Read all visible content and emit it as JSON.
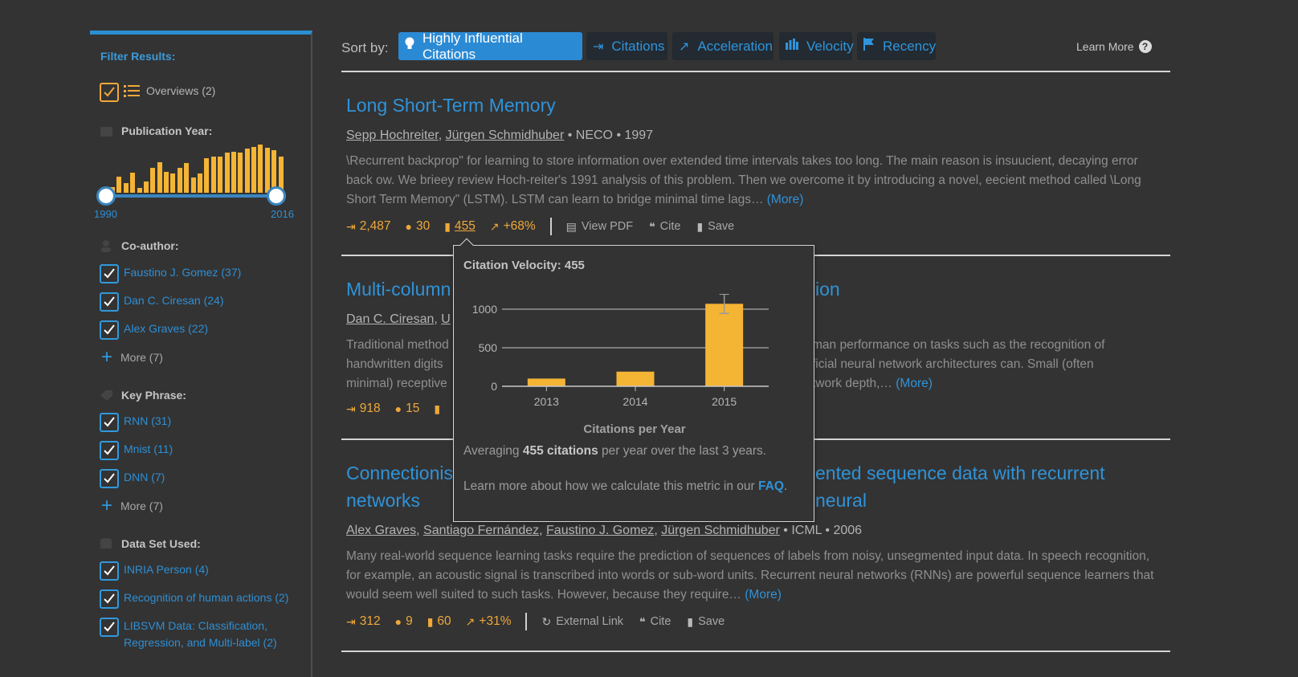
{
  "sidebar": {
    "filter_title": "Filter Results:",
    "overviews_label": "Overviews (2)",
    "pub_year_heading": "Publication Year:",
    "year_start": "1990",
    "year_end": "2016",
    "histogram_levels": [
      0.12,
      0.32,
      0.2,
      0.4,
      0.1,
      0.22,
      0.5,
      0.62,
      0.42,
      0.38,
      0.5,
      0.6,
      0.3,
      0.38,
      0.7,
      0.72,
      0.72,
      0.8,
      0.82,
      0.8,
      0.88,
      0.92,
      0.96,
      0.9,
      0.86,
      0.72
    ],
    "coauthor_heading": "Co-author:",
    "coauthors": [
      "Faustino J. Gomez (37)",
      "Dan C. Ciresan (24)",
      "Alex Graves (22)"
    ],
    "coauthor_more": "More (7)",
    "keyphrase_heading": "Key Phrase:",
    "keyphrases": [
      "RNN (31)",
      "Mnist (11)",
      "DNN (7)"
    ],
    "keyphrase_more": "More (7)",
    "dataset_heading": "Data Set Used:",
    "datasets": [
      "INRIA Person (4)",
      "Recognition of human actions (2)",
      "LIBSVM Data: Classification, Regression, and Multi-label (2)"
    ]
  },
  "sortbar": {
    "label": "Sort by:",
    "options": [
      "Highly Influential Citations",
      "Citations",
      "Acceleration",
      "Velocity",
      "Recency"
    ],
    "learn_more": "Learn More",
    "help_glyph": "?"
  },
  "results": [
    {
      "title": "Long Short-Term Memory",
      "authors": [
        "Sepp Hochreiter",
        "Jürgen Schmidhuber"
      ],
      "venue_year": "• NECO • 1997",
      "abstract": "\\Recurrent backprop\" for learning to store information over extended time intervals takes too long. The main reason is insuucient, decaying error back ow. We brieey review Hoch-reiter's 1991 analysis of this problem. Then we overcome it by introducing a novel, eecient method called \\Long Short Term Memory\" (LSTM). LSTM can learn to bridge minimal time lags…",
      "more": "(More)",
      "citations": "2,487",
      "influential": "30",
      "velocity": "455",
      "acceleration": "+68%",
      "actions": [
        "View PDF",
        "Cite",
        "Save"
      ]
    },
    {
      "title_left": "Multi-column",
      "title_right": "ion",
      "authors_left": "Dan C. Ciresan",
      "authors_cut": "U",
      "abstract_left": [
        "Traditional method",
        "handwritten digits",
        "minimal) receptive"
      ],
      "abstract_right": [
        "man performance on tasks such as the recognition of",
        "ficial neural network architectures can. Small (often",
        "twork depth,…"
      ],
      "more": "(More)",
      "citations": "918",
      "influential": "15"
    },
    {
      "title_left": "Connectionis",
      "title_right": "ented sequence data with recurrent neural",
      "title_line2": "networks",
      "authors": [
        "Alex Graves",
        "Santiago Fernández",
        "Faustino J. Gomez",
        "Jürgen Schmidhuber"
      ],
      "venue_year": "• ICML • 2006",
      "abstract": "Many real-world sequence learning tasks require the prediction of sequences of labels from noisy, unsegmented input data. In speech recognition, for example, an acoustic signal is transcribed into words or sub-word units. Recurrent neural networks (RNNs) are powerful sequence learners that would seem well suited to such tasks. However, because they require…",
      "more": "(More)",
      "citations": "312",
      "influential": "9",
      "velocity": "60",
      "acceleration": "+31%",
      "actions": [
        "External Link",
        "Cite",
        "Save"
      ]
    }
  ],
  "popup": {
    "title": "Citation Velocity: 455",
    "chart_title": "Citations per Year",
    "avg_prefix": "Averaging ",
    "avg_bold": "455 citations",
    "avg_suffix": " per year over the last 3 years.",
    "faq_text": "Learn more about how we calculate this metric in our ",
    "faq_link": "FAQ",
    "faq_end": "."
  },
  "chart_data": {
    "type": "bar",
    "categories": [
      "2013",
      "2014",
      "2015"
    ],
    "values": [
      100,
      190,
      1070
    ],
    "title": "Citations per Year",
    "xlabel": "",
    "ylabel": "",
    "ylim": [
      0,
      1000
    ],
    "yticks": [
      "0",
      "500",
      "1000"
    ],
    "error_bar_on": "2015",
    "bar_color": "#f4b434",
    "grid": true
  },
  "colors": {
    "accent": "#2f93d9",
    "metric": "#f0a83a",
    "background": "#333333"
  }
}
